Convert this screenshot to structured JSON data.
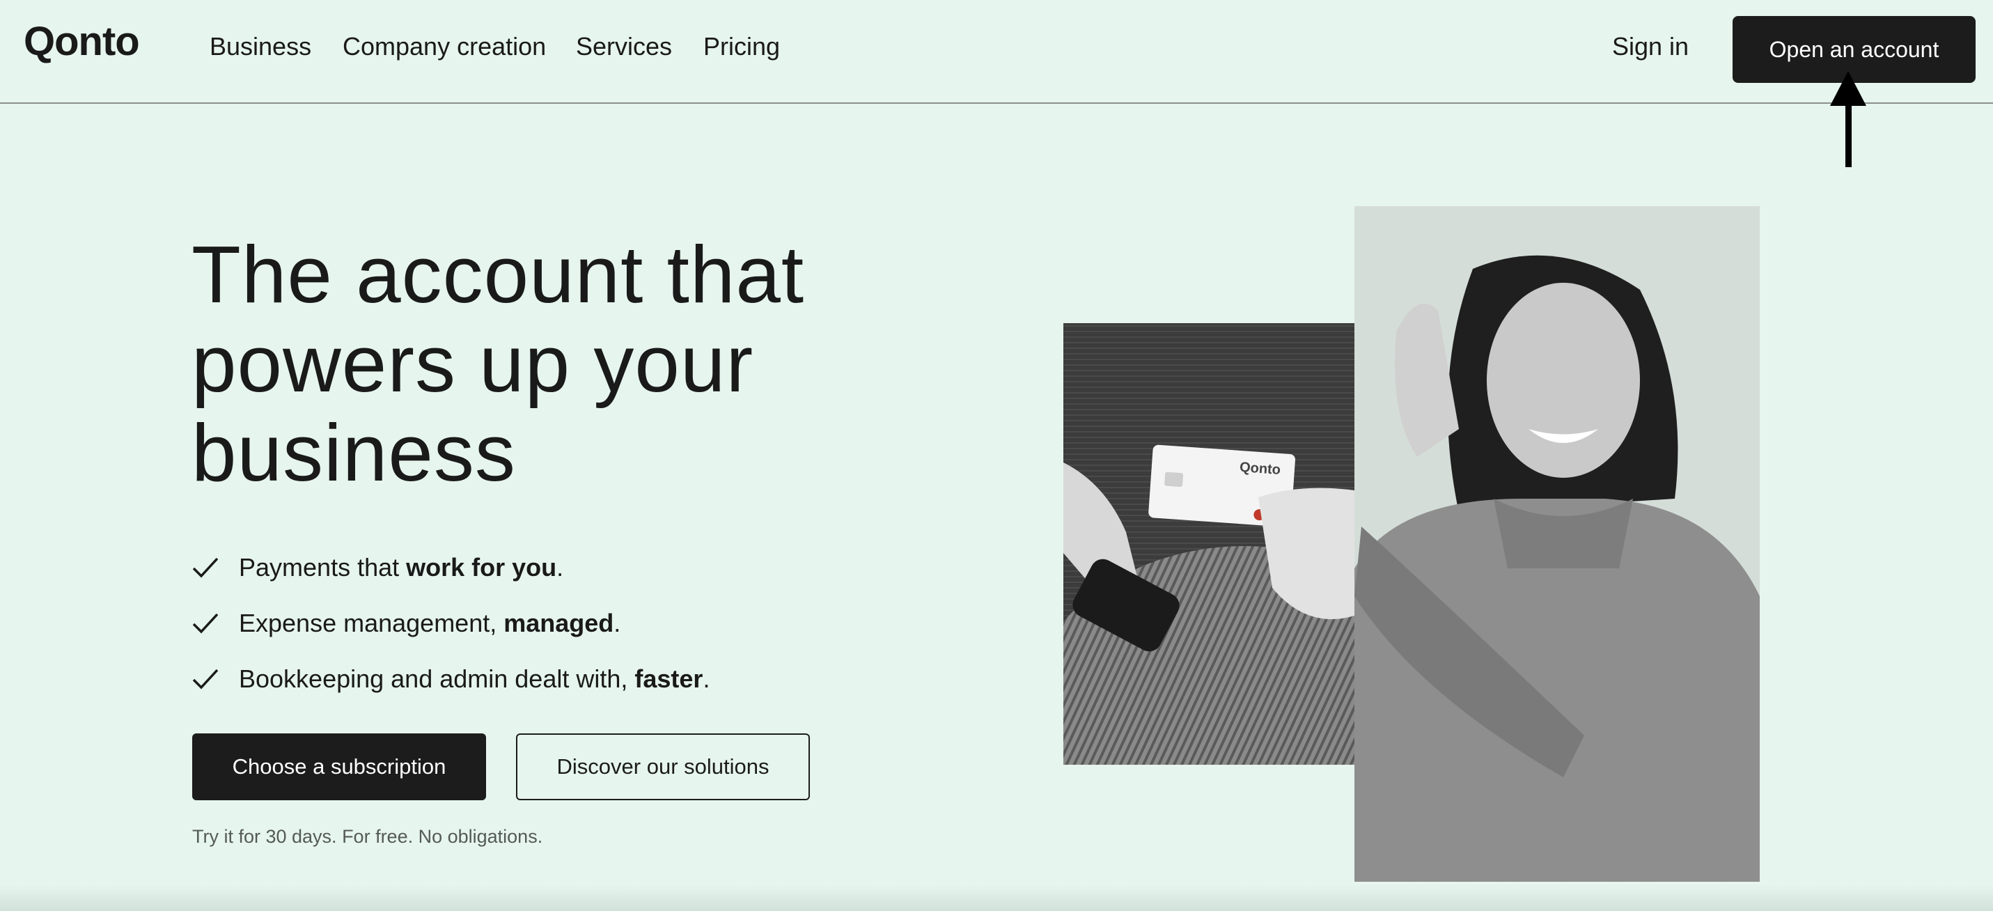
{
  "header": {
    "logo": "Qonto",
    "nav": [
      {
        "label": "Business"
      },
      {
        "label": "Company creation"
      },
      {
        "label": "Services"
      },
      {
        "label": "Pricing"
      }
    ],
    "sign_in": "Sign in",
    "open_account": "Open an account"
  },
  "hero": {
    "title": "The account that powers up your business",
    "features": [
      {
        "prefix": "Payments that ",
        "bold": "work for you",
        "suffix": "."
      },
      {
        "prefix": "Expense management, ",
        "bold": "managed",
        "suffix": "."
      },
      {
        "prefix": "Bookkeeping and admin dealt with, ",
        "bold": "faster",
        "suffix": "."
      }
    ],
    "primary_cta": "Choose a subscription",
    "secondary_cta": "Discover our solutions",
    "trial_note": "Try it for 30 days. For free. No obligations."
  },
  "images": {
    "card_brand": "Qonto"
  },
  "colors": {
    "background": "#e6f5ee",
    "button_dark": "#1c1c1c",
    "text": "#1a1a1a"
  }
}
